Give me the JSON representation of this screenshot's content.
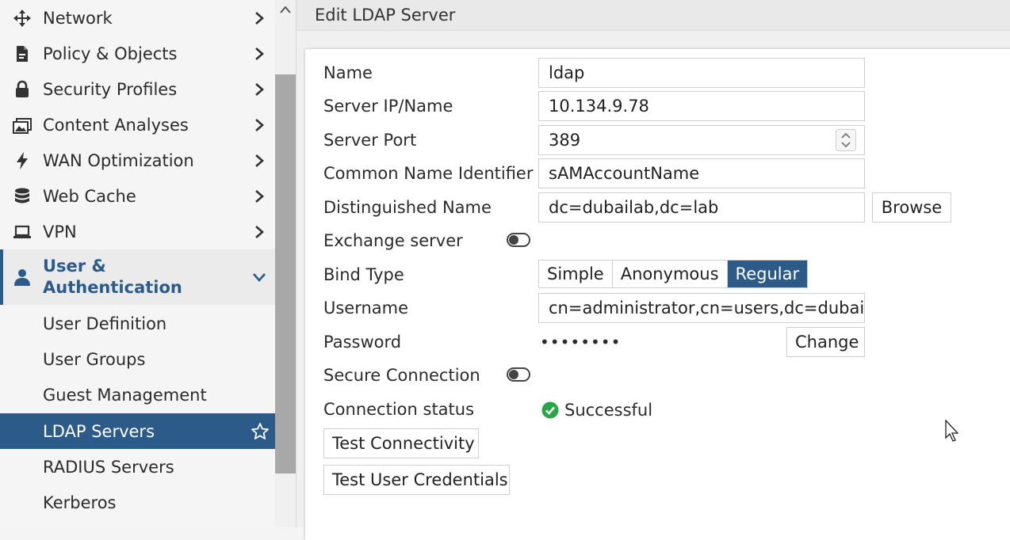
{
  "sidebar": {
    "items": [
      {
        "label": "Network",
        "icon": "move-arrows-icon"
      },
      {
        "label": "Policy & Objects",
        "icon": "document-icon"
      },
      {
        "label": "Security Profiles",
        "icon": "lock-icon"
      },
      {
        "label": "Content Analyses",
        "icon": "images-icon"
      },
      {
        "label": "WAN Optimization",
        "icon": "lightning-icon"
      },
      {
        "label": "Web Cache",
        "icon": "database-icon"
      },
      {
        "label": "VPN",
        "icon": "laptop-icon"
      }
    ],
    "expanded": {
      "label_line1": "User &",
      "label_line2": "Authentication",
      "icon": "user-icon"
    },
    "subitems": [
      {
        "label": "User Definition"
      },
      {
        "label": "User Groups"
      },
      {
        "label": "Guest Management"
      },
      {
        "label": "LDAP Servers",
        "active": true
      },
      {
        "label": "RADIUS Servers"
      },
      {
        "label": "Kerberos"
      }
    ]
  },
  "main": {
    "title": "Edit LDAP Server",
    "form": {
      "name_label": "Name",
      "name_value": "ldap",
      "server_label": "Server IP/Name",
      "server_value": "10.134.9.78",
      "port_label": "Server Port",
      "port_value": "389",
      "cn_label": "Common Name Identifier",
      "cn_value": "sAMAccountName",
      "dn_label": "Distinguished Name",
      "dn_value": "dc=dubailab,dc=lab",
      "browse_label": "Browse",
      "exchange_label": "Exchange server",
      "bind_label": "Bind Type",
      "bind_options": [
        "Simple",
        "Anonymous",
        "Regular"
      ],
      "bind_selected": "Regular",
      "username_label": "Username",
      "username_value": "cn=administrator,cn=users,dc=dubailab",
      "password_label": "Password",
      "password_mask": "••••••••",
      "change_label": "Change",
      "secure_label": "Secure Connection",
      "status_label": "Connection status",
      "status_value": "Successful",
      "test_conn_label": "Test Connectivity",
      "test_cred_label": "Test User Credentials"
    }
  },
  "colors": {
    "accent": "#2c5b8a",
    "success": "#27a745"
  }
}
